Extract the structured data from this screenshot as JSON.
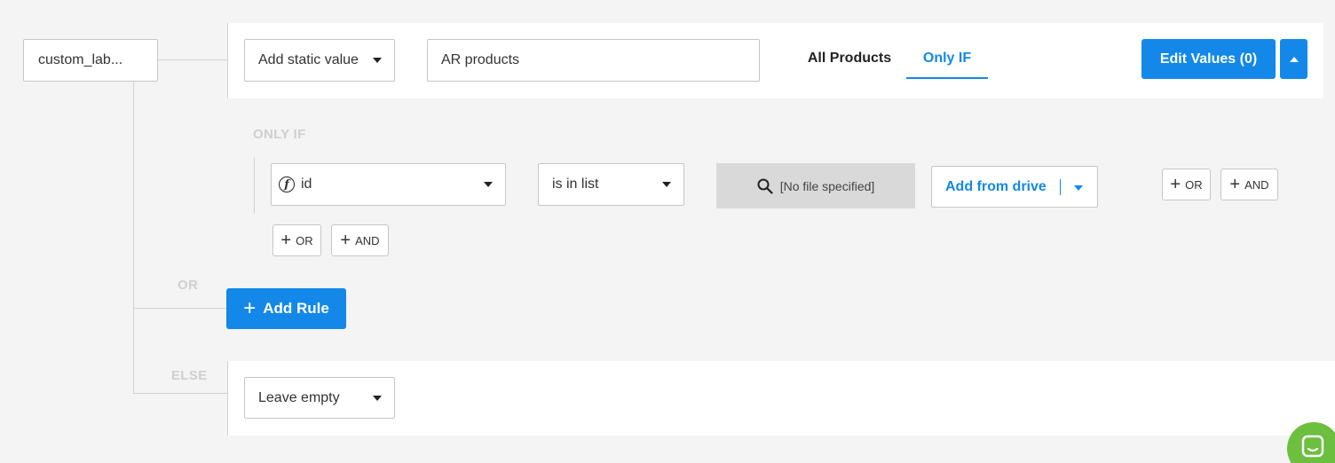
{
  "field": {
    "name": "custom_lab..."
  },
  "rule": {
    "value_type": "Add static value",
    "value_input": "AR products",
    "tabs": [
      {
        "label": "All Products",
        "active": false
      },
      {
        "label": "Only IF",
        "active": true
      }
    ],
    "edit_values_label": "Edit Values (0)"
  },
  "condition": {
    "section_label": "ONLY IF",
    "field_label": "id",
    "operator_label": "is in list",
    "file_label": "[No file specified]",
    "drive_label": "Add from drive",
    "or_label": "OR",
    "and_label": "AND"
  },
  "connectors": {
    "or": "OR",
    "else": "ELSE"
  },
  "add_rule_label": "Add Rule",
  "else_value": "Leave empty",
  "colors": {
    "accent": "#1388e8",
    "background": "#f4f4f4",
    "chat_bubble": "#6cbf3f"
  },
  "icons": {
    "search": "search-icon",
    "function": "function-icon",
    "chat": "chat-icon"
  }
}
